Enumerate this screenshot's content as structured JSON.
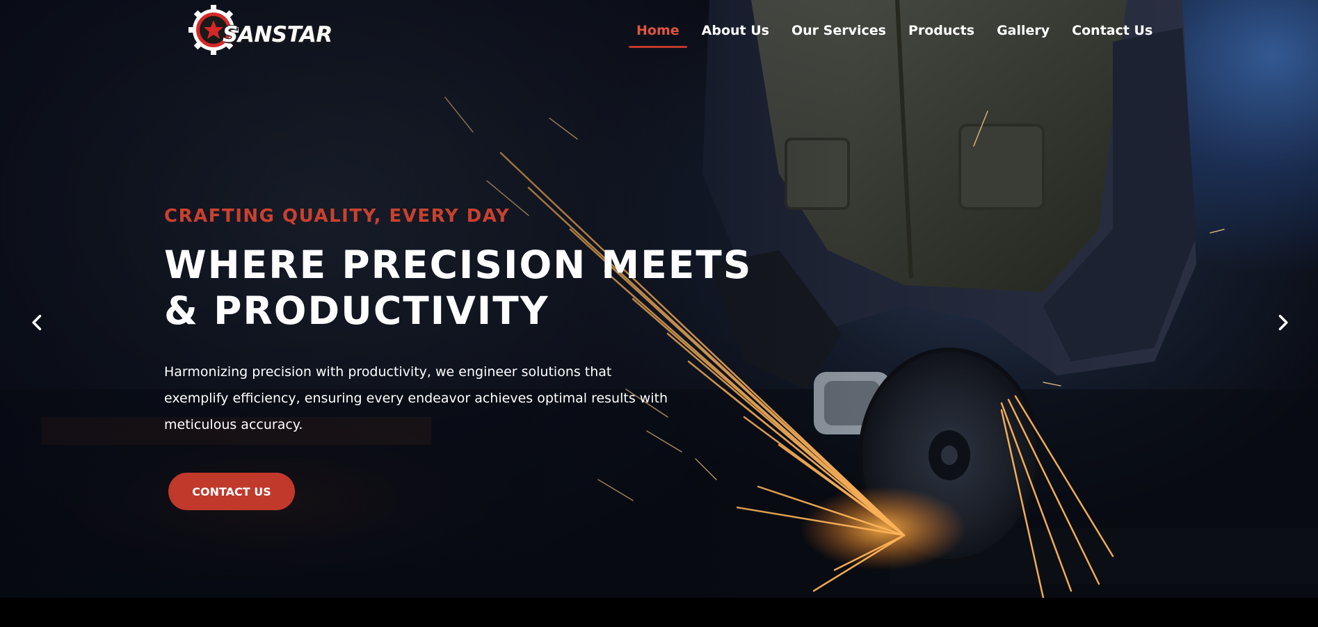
{
  "brand": {
    "logo_text": "SANSTAR",
    "logo_icon": "gear-star-icon",
    "accent_color": "#c0392b"
  },
  "nav": {
    "items": [
      {
        "label": "Home",
        "active": true
      },
      {
        "label": "About Us",
        "active": false
      },
      {
        "label": "Our Services",
        "active": false
      },
      {
        "label": "Products",
        "active": false
      },
      {
        "label": "Gallery",
        "active": false
      },
      {
        "label": "Contact Us",
        "active": false
      }
    ]
  },
  "hero": {
    "eyebrow": "CRAFTING QUALITY, EVERY DAY",
    "headline_line1": "WHERE PRECISION MEETS",
    "headline_line2": "& PRODUCTIVITY",
    "description": "Harmonizing precision with productivity, we engineer solutions that exemplify efficiency, ensuring every endeavor achieves optimal results with meticulous accuracy.",
    "cta_label": "CONTACT US",
    "prev_icon": "chevron-left-icon",
    "next_icon": "chevron-right-icon"
  }
}
